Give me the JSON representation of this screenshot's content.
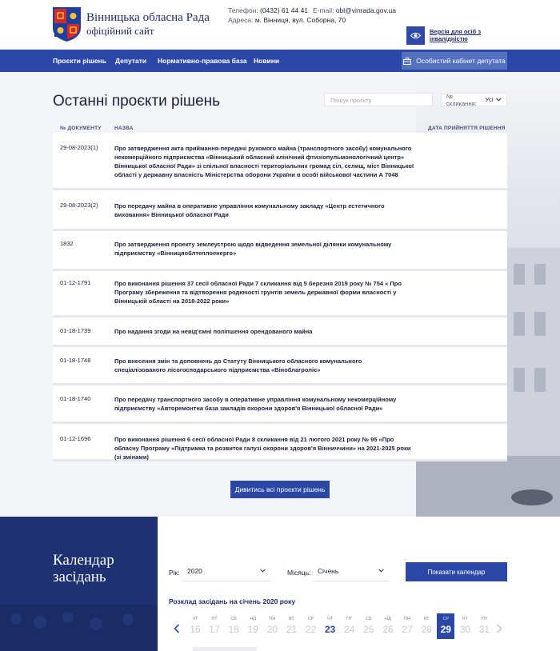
{
  "header": {
    "site_name": "Вінницька обласна Рада",
    "site_subtitle": "офіційний сайт",
    "phone_label": "Телефон:",
    "phone_value": "(0432) 61 44 41",
    "email_label": "E-mail:",
    "email_value": "obl@vinrada.gov.ua",
    "address_label": "Адреса:",
    "address_value": "м. Вінниця, вул. Соборна, 70",
    "a11y_label": "Версія для осіб з інвалідністю"
  },
  "nav": {
    "items": [
      "Проєкти рішень",
      "Депутати",
      "Нормативно-правова база",
      "Новини"
    ],
    "cabinet_label": "Особистий кабінет депутата"
  },
  "projects": {
    "title": "Останні проєкти рішень",
    "search_placeholder": "Пошук проєкту",
    "convocation_label": "№ скликання:",
    "convocation_value": "Усі",
    "col_number": "№ ДОКУМЕНТУ",
    "col_name": "НАЗВА",
    "col_date": "ДАТА ПРИЙНЯТТЯ РІШЕННЯ",
    "rows": [
      {
        "number": "29-08-2023(1)",
        "name": "Про затвердження акта приймання-передачі рухомого майна (транспортного засобу) комунального некомерційного підприємства «Вінницький обласний клінічний фтизіопульмонологічний центр» Вінницької обласної Ради» зі спільної власності територіальних громад сіл, селищ, міст Вінницької області у державну власність Міністерства оборони України в особі військової частини А 7048"
      },
      {
        "number": "29-08-2023(2)",
        "name": "Про передачу майна в оперативне управління комунальному закладу «Центр естетичного виховання» Вінницької обласної Ради"
      },
      {
        "number": "1832",
        "name": "Про затвердження проекту землеустрою щодо відведення земельної ділянки комунальному підприємству «Вінницяоблтеплоенерго»"
      },
      {
        "number": "01-12-1791",
        "name": "Про виконання рішення 37 сесії обласної Ради 7 скликання від 5 березня 2019 року № 754 « Про Програму збереження та відтворення родючості грунтів земель державної форми власності у Вінницькій області на 2018-2022 роки»"
      },
      {
        "number": "01-18-1739",
        "name": "Про надання згоди на невід'ємні поліпшення орендованого майна"
      },
      {
        "number": "01-18-1748",
        "name": "Про внесення змін та доповнень до Статуту Вінницького обласного комунального спеціалізованого лісогосподарського підприємства «Віноблагроліс»"
      },
      {
        "number": "01-18-1740",
        "name": "Про передачу транспортного засобу в оперативне управління комунальному некомерційному підприємству «Авторемонтна база закладів охорони здоров'я Вінницької обласної Ради»"
      },
      {
        "number": "01-12-1696",
        "name": "Про виконання рішення 6 сесії обласної Ради 8 скликання від 21 лютого 2021 року № 95 «Про обласну Програму «Підтримка та розвиток галузі охорони здоров'я Вінниччини» на 2021-2025 роки (зі змінами)"
      }
    ],
    "view_all_label": "Дивитись всі проєкти рішень"
  },
  "calendar": {
    "title_line1": "Календар",
    "title_line2": "засідань",
    "year_label": "Рік:",
    "year_value": "2020",
    "month_label": "Місяць:",
    "month_value": "Січень",
    "show_label": "Показати календар",
    "schedule_title": "Розклад засідань на січень 2020 року",
    "days": [
      {
        "dow": "ЧТ",
        "num": "16",
        "state": "plain"
      },
      {
        "dow": "ПТ",
        "num": "17",
        "state": "plain"
      },
      {
        "dow": "СБ",
        "num": "18",
        "state": "plain"
      },
      {
        "dow": "НД",
        "num": "19",
        "state": "plain"
      },
      {
        "dow": "ПН",
        "num": "20",
        "state": "plain"
      },
      {
        "dow": "ВТ",
        "num": "21",
        "state": "plain"
      },
      {
        "dow": "СР",
        "num": "22",
        "state": "plain"
      },
      {
        "dow": "ЧТ",
        "num": "23",
        "state": "has"
      },
      {
        "dow": "ПТ",
        "num": "24",
        "state": "plain"
      },
      {
        "dow": "СБ",
        "num": "25",
        "state": "plain"
      },
      {
        "dow": "НД",
        "num": "26",
        "state": "plain"
      },
      {
        "dow": "ПН",
        "num": "27",
        "state": "plain"
      },
      {
        "dow": "ВТ",
        "num": "28",
        "state": "plain"
      },
      {
        "dow": "СР",
        "num": "29",
        "state": "active"
      },
      {
        "dow": "ЧТ",
        "num": "30",
        "state": "plain"
      },
      {
        "dow": "ПТ",
        "num": "31",
        "state": "plain"
      }
    ]
  },
  "colors": {
    "primary": "#2c48a7",
    "dark_navy": "#1e3273",
    "page_bg": "#f4f5f8"
  },
  "icons": {
    "logo": "coat-of-arms-icon",
    "a11y": "eye-icon",
    "cabinet": "briefcase-icon"
  }
}
